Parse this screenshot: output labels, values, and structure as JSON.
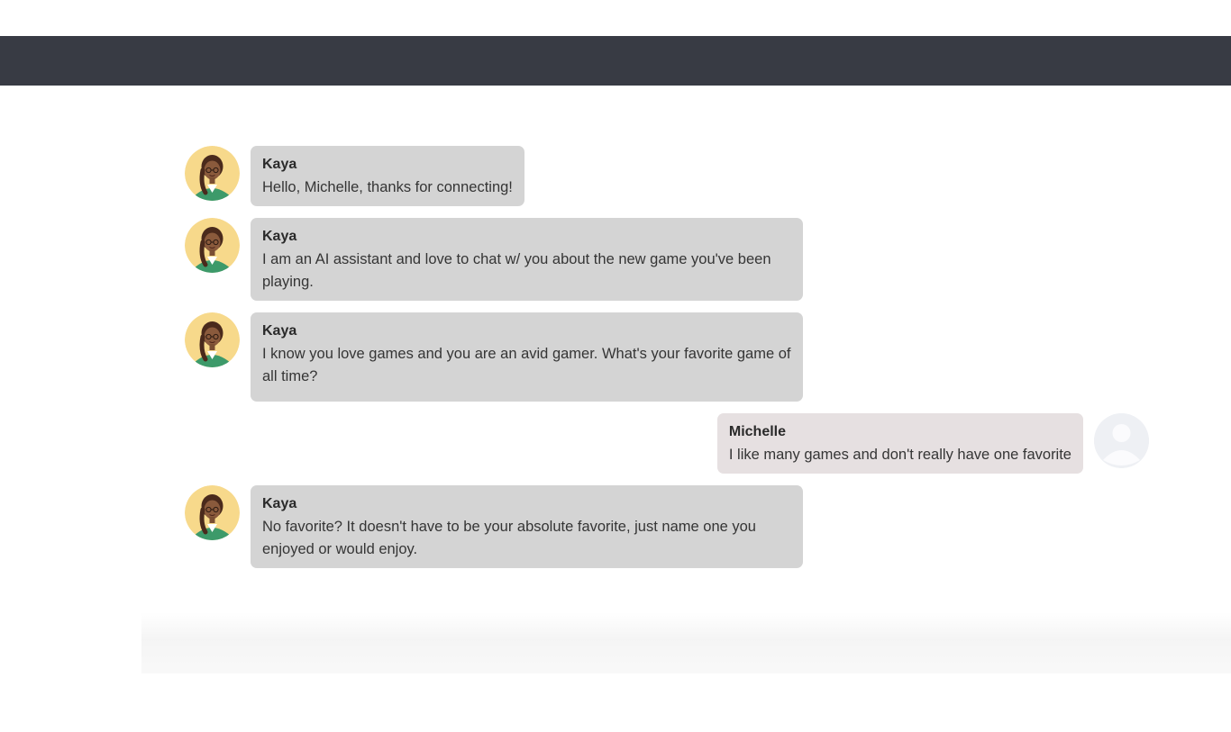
{
  "conversation": [
    {
      "role": "assistant",
      "sender": "Kaya",
      "avatar_icon": "kaya-avatar-icon",
      "text": "Hello, Michelle, thanks for connecting!"
    },
    {
      "role": "assistant",
      "sender": "Kaya",
      "avatar_icon": "kaya-avatar-icon",
      "text": "I am an AI assistant and love to chat w/ you about the new game you've been playing."
    },
    {
      "role": "assistant",
      "sender": "Kaya",
      "avatar_icon": "kaya-avatar-icon",
      "text": "I know you love games and you are an avid gamer. What's your favorite game of all time?"
    },
    {
      "role": "user",
      "sender": "Michelle",
      "avatar_icon": "user-avatar-icon",
      "text": "I like many games and don't really have one favorite"
    },
    {
      "role": "assistant",
      "sender": "Kaya",
      "avatar_icon": "kaya-avatar-icon",
      "text": "No favorite? It doesn't have to be your absolute favorite, just name one you enjoyed or would enjoy."
    }
  ],
  "colors": {
    "header_bar": "#383b44",
    "assistant_bubble": "#d4d4d4",
    "user_bubble": "#e6e0e1",
    "avatar_background": "#f7d98b"
  }
}
